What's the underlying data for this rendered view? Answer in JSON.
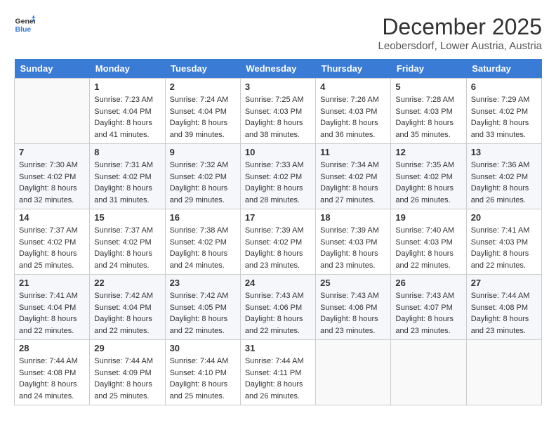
{
  "header": {
    "logo_line1": "General",
    "logo_line2": "Blue",
    "month": "December 2025",
    "location": "Leobersdorf, Lower Austria, Austria"
  },
  "days_of_week": [
    "Sunday",
    "Monday",
    "Tuesday",
    "Wednesday",
    "Thursday",
    "Friday",
    "Saturday"
  ],
  "weeks": [
    [
      {
        "day": "",
        "info": ""
      },
      {
        "day": "1",
        "info": "Sunrise: 7:23 AM\nSunset: 4:04 PM\nDaylight: 8 hours\nand 41 minutes."
      },
      {
        "day": "2",
        "info": "Sunrise: 7:24 AM\nSunset: 4:04 PM\nDaylight: 8 hours\nand 39 minutes."
      },
      {
        "day": "3",
        "info": "Sunrise: 7:25 AM\nSunset: 4:03 PM\nDaylight: 8 hours\nand 38 minutes."
      },
      {
        "day": "4",
        "info": "Sunrise: 7:26 AM\nSunset: 4:03 PM\nDaylight: 8 hours\nand 36 minutes."
      },
      {
        "day": "5",
        "info": "Sunrise: 7:28 AM\nSunset: 4:03 PM\nDaylight: 8 hours\nand 35 minutes."
      },
      {
        "day": "6",
        "info": "Sunrise: 7:29 AM\nSunset: 4:02 PM\nDaylight: 8 hours\nand 33 minutes."
      }
    ],
    [
      {
        "day": "7",
        "info": "Sunrise: 7:30 AM\nSunset: 4:02 PM\nDaylight: 8 hours\nand 32 minutes."
      },
      {
        "day": "8",
        "info": "Sunrise: 7:31 AM\nSunset: 4:02 PM\nDaylight: 8 hours\nand 31 minutes."
      },
      {
        "day": "9",
        "info": "Sunrise: 7:32 AM\nSunset: 4:02 PM\nDaylight: 8 hours\nand 29 minutes."
      },
      {
        "day": "10",
        "info": "Sunrise: 7:33 AM\nSunset: 4:02 PM\nDaylight: 8 hours\nand 28 minutes."
      },
      {
        "day": "11",
        "info": "Sunrise: 7:34 AM\nSunset: 4:02 PM\nDaylight: 8 hours\nand 27 minutes."
      },
      {
        "day": "12",
        "info": "Sunrise: 7:35 AM\nSunset: 4:02 PM\nDaylight: 8 hours\nand 26 minutes."
      },
      {
        "day": "13",
        "info": "Sunrise: 7:36 AM\nSunset: 4:02 PM\nDaylight: 8 hours\nand 26 minutes."
      }
    ],
    [
      {
        "day": "14",
        "info": "Sunrise: 7:37 AM\nSunset: 4:02 PM\nDaylight: 8 hours\nand 25 minutes."
      },
      {
        "day": "15",
        "info": "Sunrise: 7:37 AM\nSunset: 4:02 PM\nDaylight: 8 hours\nand 24 minutes."
      },
      {
        "day": "16",
        "info": "Sunrise: 7:38 AM\nSunset: 4:02 PM\nDaylight: 8 hours\nand 24 minutes."
      },
      {
        "day": "17",
        "info": "Sunrise: 7:39 AM\nSunset: 4:02 PM\nDaylight: 8 hours\nand 23 minutes."
      },
      {
        "day": "18",
        "info": "Sunrise: 7:39 AM\nSunset: 4:03 PM\nDaylight: 8 hours\nand 23 minutes."
      },
      {
        "day": "19",
        "info": "Sunrise: 7:40 AM\nSunset: 4:03 PM\nDaylight: 8 hours\nand 22 minutes."
      },
      {
        "day": "20",
        "info": "Sunrise: 7:41 AM\nSunset: 4:03 PM\nDaylight: 8 hours\nand 22 minutes."
      }
    ],
    [
      {
        "day": "21",
        "info": "Sunrise: 7:41 AM\nSunset: 4:04 PM\nDaylight: 8 hours\nand 22 minutes."
      },
      {
        "day": "22",
        "info": "Sunrise: 7:42 AM\nSunset: 4:04 PM\nDaylight: 8 hours\nand 22 minutes."
      },
      {
        "day": "23",
        "info": "Sunrise: 7:42 AM\nSunset: 4:05 PM\nDaylight: 8 hours\nand 22 minutes."
      },
      {
        "day": "24",
        "info": "Sunrise: 7:43 AM\nSunset: 4:06 PM\nDaylight: 8 hours\nand 22 minutes."
      },
      {
        "day": "25",
        "info": "Sunrise: 7:43 AM\nSunset: 4:06 PM\nDaylight: 8 hours\nand 23 minutes."
      },
      {
        "day": "26",
        "info": "Sunrise: 7:43 AM\nSunset: 4:07 PM\nDaylight: 8 hours\nand 23 minutes."
      },
      {
        "day": "27",
        "info": "Sunrise: 7:44 AM\nSunset: 4:08 PM\nDaylight: 8 hours\nand 23 minutes."
      }
    ],
    [
      {
        "day": "28",
        "info": "Sunrise: 7:44 AM\nSunset: 4:08 PM\nDaylight: 8 hours\nand 24 minutes."
      },
      {
        "day": "29",
        "info": "Sunrise: 7:44 AM\nSunset: 4:09 PM\nDaylight: 8 hours\nand 25 minutes."
      },
      {
        "day": "30",
        "info": "Sunrise: 7:44 AM\nSunset: 4:10 PM\nDaylight: 8 hours\nand 25 minutes."
      },
      {
        "day": "31",
        "info": "Sunrise: 7:44 AM\nSunset: 4:11 PM\nDaylight: 8 hours\nand 26 minutes."
      },
      {
        "day": "",
        "info": ""
      },
      {
        "day": "",
        "info": ""
      },
      {
        "day": "",
        "info": ""
      }
    ]
  ]
}
